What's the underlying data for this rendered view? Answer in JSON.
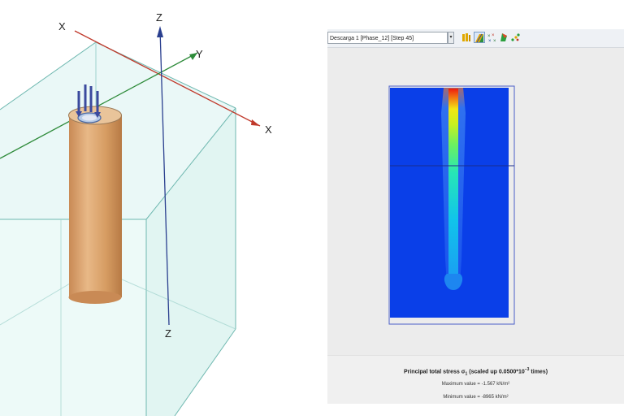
{
  "model_view": {
    "axis_labels": {
      "x_back": "X",
      "x_front": "X",
      "y": "Y",
      "z_top": "Z",
      "z_bottom": "Z"
    }
  },
  "toolbar": {
    "phase_select_value": "Descarga 1 [Phase_12] [Step 45]",
    "icons": [
      "stress-bars-icon",
      "shading-icon",
      "principal-directions-icon",
      "contour-icon",
      "cross-section-icon"
    ]
  },
  "result": {
    "title_prefix": "Principal total stress σ",
    "title_subscript": "1",
    "title_scale": " (scaled up 0.0500*10",
    "title_exponent": "−3",
    "title_suffix": " times)",
    "maximum_value": "Maximum value = -1.567 kN/m²",
    "minimum_value": "Minimum value = -8965 kN/m²"
  },
  "colors": {
    "soil_blue": "#0a3fe8",
    "pile_tan": "#dba46f",
    "x_axis": "#c0392b",
    "y_axis": "#2e8b3a",
    "z_axis": "#2a3f8f"
  }
}
